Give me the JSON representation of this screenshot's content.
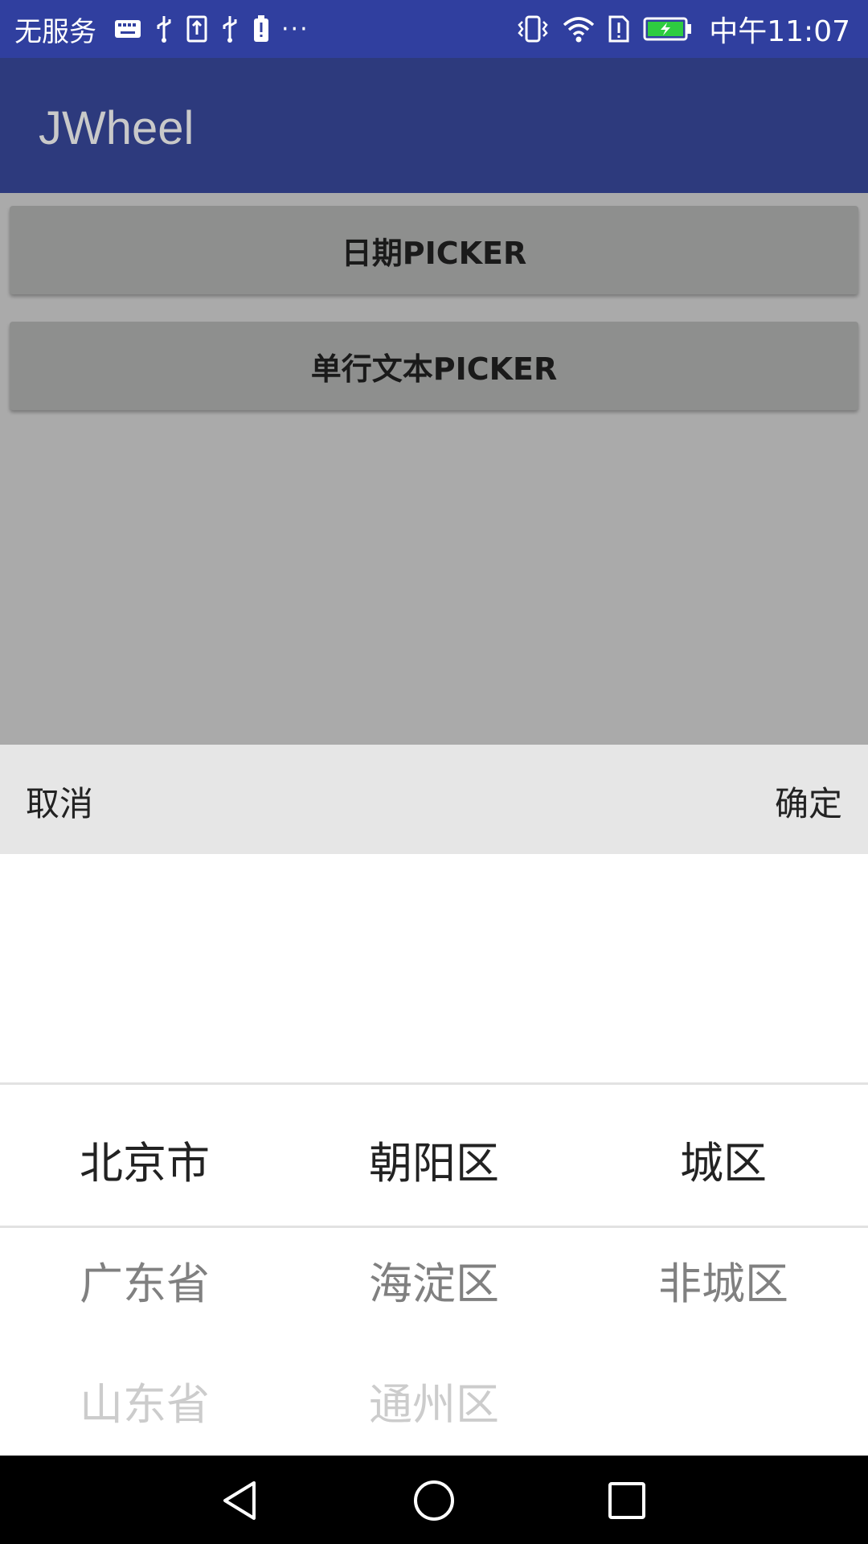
{
  "status_bar": {
    "carrier": "无服务",
    "time": "中午11:07",
    "overflow": "···",
    "icons_left": [
      "keyboard-icon",
      "usb-icon",
      "upload-icon",
      "usb-icon",
      "battery-alert-icon"
    ],
    "icons_right": [
      "vibrate-icon",
      "wifi-icon",
      "sim-alert-icon",
      "battery-charging-icon"
    ],
    "colors": {
      "background": "#303f9f",
      "battery_fill": "#2ecc40"
    }
  },
  "app_bar": {
    "title": "JWheel",
    "color": "#2d3a7d"
  },
  "buttons": {
    "date_picker": "日期PICKER",
    "text_picker": "单行文本PICKER"
  },
  "picker": {
    "cancel": "取消",
    "confirm": "确定",
    "columns": [
      {
        "selected": "北京市",
        "next1": "广东省",
        "next2": "山东省"
      },
      {
        "selected": "朝阳区",
        "next1": "海淀区",
        "next2": "通州区"
      },
      {
        "selected": "城区",
        "next1": "非城区",
        "next2": ""
      }
    ]
  },
  "nav_bar": {
    "icons": [
      "back-triangle-icon",
      "home-circle-icon",
      "recents-square-icon"
    ]
  }
}
